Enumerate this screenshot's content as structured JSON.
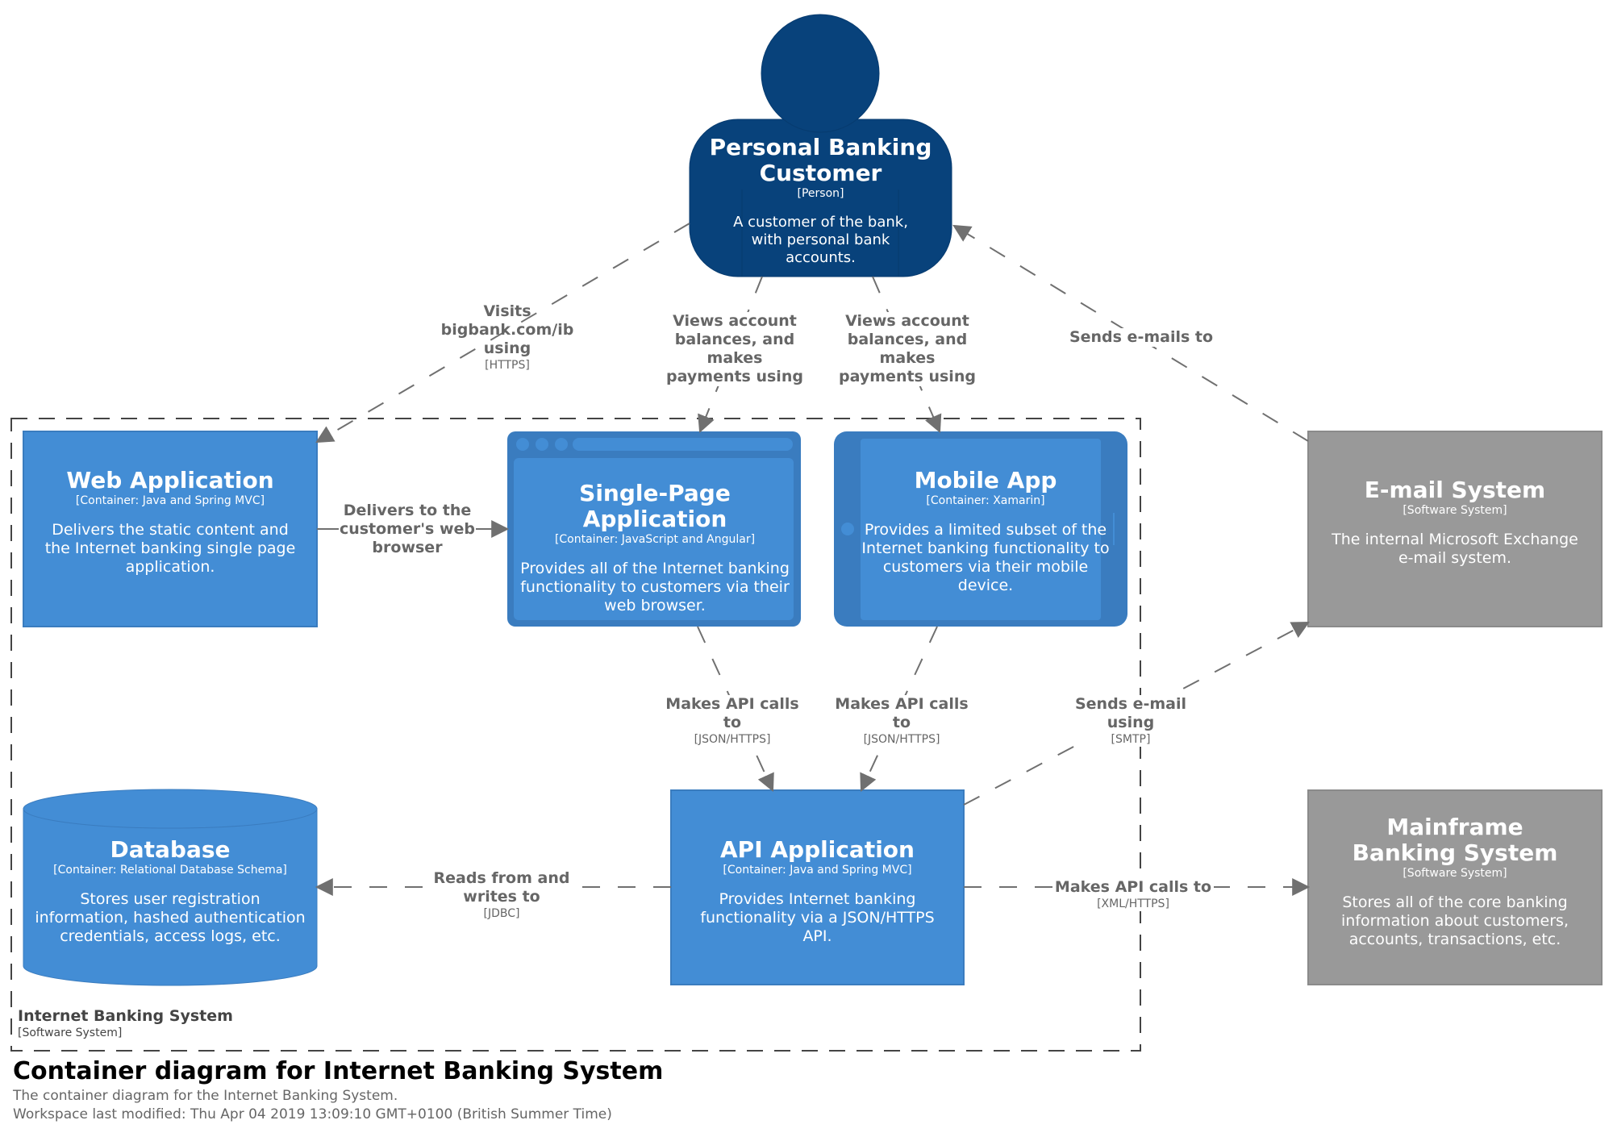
{
  "diagram": {
    "title": "Container diagram for Internet Banking System",
    "description": "The container diagram for the Internet Banking System.",
    "last_modified": "Workspace last modified: Thu Apr 04 2019 13:09:10 GMT+0100 (British Summer Time)"
  },
  "colors": {
    "person": "#08427b",
    "container": "#438dd5",
    "container_dark": "#3a7cbf",
    "external_system": "#999999",
    "relationship": "#707070",
    "boundary": "#444444"
  },
  "boundary": {
    "name": "Internet Banking System",
    "type": "[Software System]"
  },
  "nodes": {
    "customer": {
      "name": "Personal Banking Customer",
      "type": "[Person]",
      "description": "A customer of the bank, with personal bank accounts.",
      "shape": "person-icon"
    },
    "web_app": {
      "name": "Web Application",
      "type": "[Container: Java and Spring MVC]",
      "description": "Delivers the static content and the Internet banking single page application.",
      "shape": "box"
    },
    "spa": {
      "name": "Single-Page Application",
      "type": "[Container: JavaScript and Angular]",
      "description": "Provides all of the Internet banking functionality to customers via their web browser.",
      "shape": "web-browser-icon"
    },
    "mobile_app": {
      "name": "Mobile App",
      "type": "[Container: Xamarin]",
      "description": "Provides a limited subset of the Internet banking functionality to customers via their mobile device.",
      "shape": "mobile-device-icon"
    },
    "email_system": {
      "name": "E-mail System",
      "type": "[Software System]",
      "description": "The internal Microsoft Exchange e-mail system.",
      "shape": "box"
    },
    "database": {
      "name": "Database",
      "type": "[Container: Relational Database Schema]",
      "description": "Stores user registration information, hashed authentication credentials, access logs, etc.",
      "shape": "cylinder-icon"
    },
    "api_app": {
      "name": "API Application",
      "type": "[Container: Java and Spring MVC]",
      "description": "Provides Internet banking functionality via a JSON/HTTPS API.",
      "shape": "box"
    },
    "mainframe": {
      "name": "Mainframe Banking System",
      "type": "[Software System]",
      "description": "Stores all of the core banking information about customers, accounts, transactions, etc.",
      "shape": "box"
    }
  },
  "relationships": [
    {
      "id": "visits",
      "from": "customer",
      "to": "web_app",
      "description": "Visits bigbank.com/ib using",
      "technology": "[HTTPS]"
    },
    {
      "id": "views-spa",
      "from": "customer",
      "to": "spa",
      "description": "Views account balances, and makes payments using",
      "technology": ""
    },
    {
      "id": "views-mobile",
      "from": "customer",
      "to": "mobile_app",
      "description": "Views account balances, and makes payments using",
      "technology": ""
    },
    {
      "id": "sends-emails",
      "from": "email_system",
      "to": "customer",
      "description": "Sends e-mails to",
      "technology": ""
    },
    {
      "id": "delivers",
      "from": "web_app",
      "to": "spa",
      "description": "Delivers to the customer's web browser",
      "technology": ""
    },
    {
      "id": "spa-api",
      "from": "spa",
      "to": "api_app",
      "description": "Makes API calls to",
      "technology": "[JSON/HTTPS]"
    },
    {
      "id": "mobile-api",
      "from": "mobile_app",
      "to": "api_app",
      "description": "Makes API calls to",
      "technology": "[JSON/HTTPS]"
    },
    {
      "id": "api-email",
      "from": "api_app",
      "to": "email_system",
      "description": "Sends e-mail using",
      "technology": "[SMTP]"
    },
    {
      "id": "api-db",
      "from": "api_app",
      "to": "database",
      "description": "Reads from and writes to",
      "technology": "[JDBC]"
    },
    {
      "id": "api-mainframe",
      "from": "api_app",
      "to": "mainframe",
      "description": "Makes API calls to",
      "technology": "[XML/HTTPS]"
    }
  ]
}
